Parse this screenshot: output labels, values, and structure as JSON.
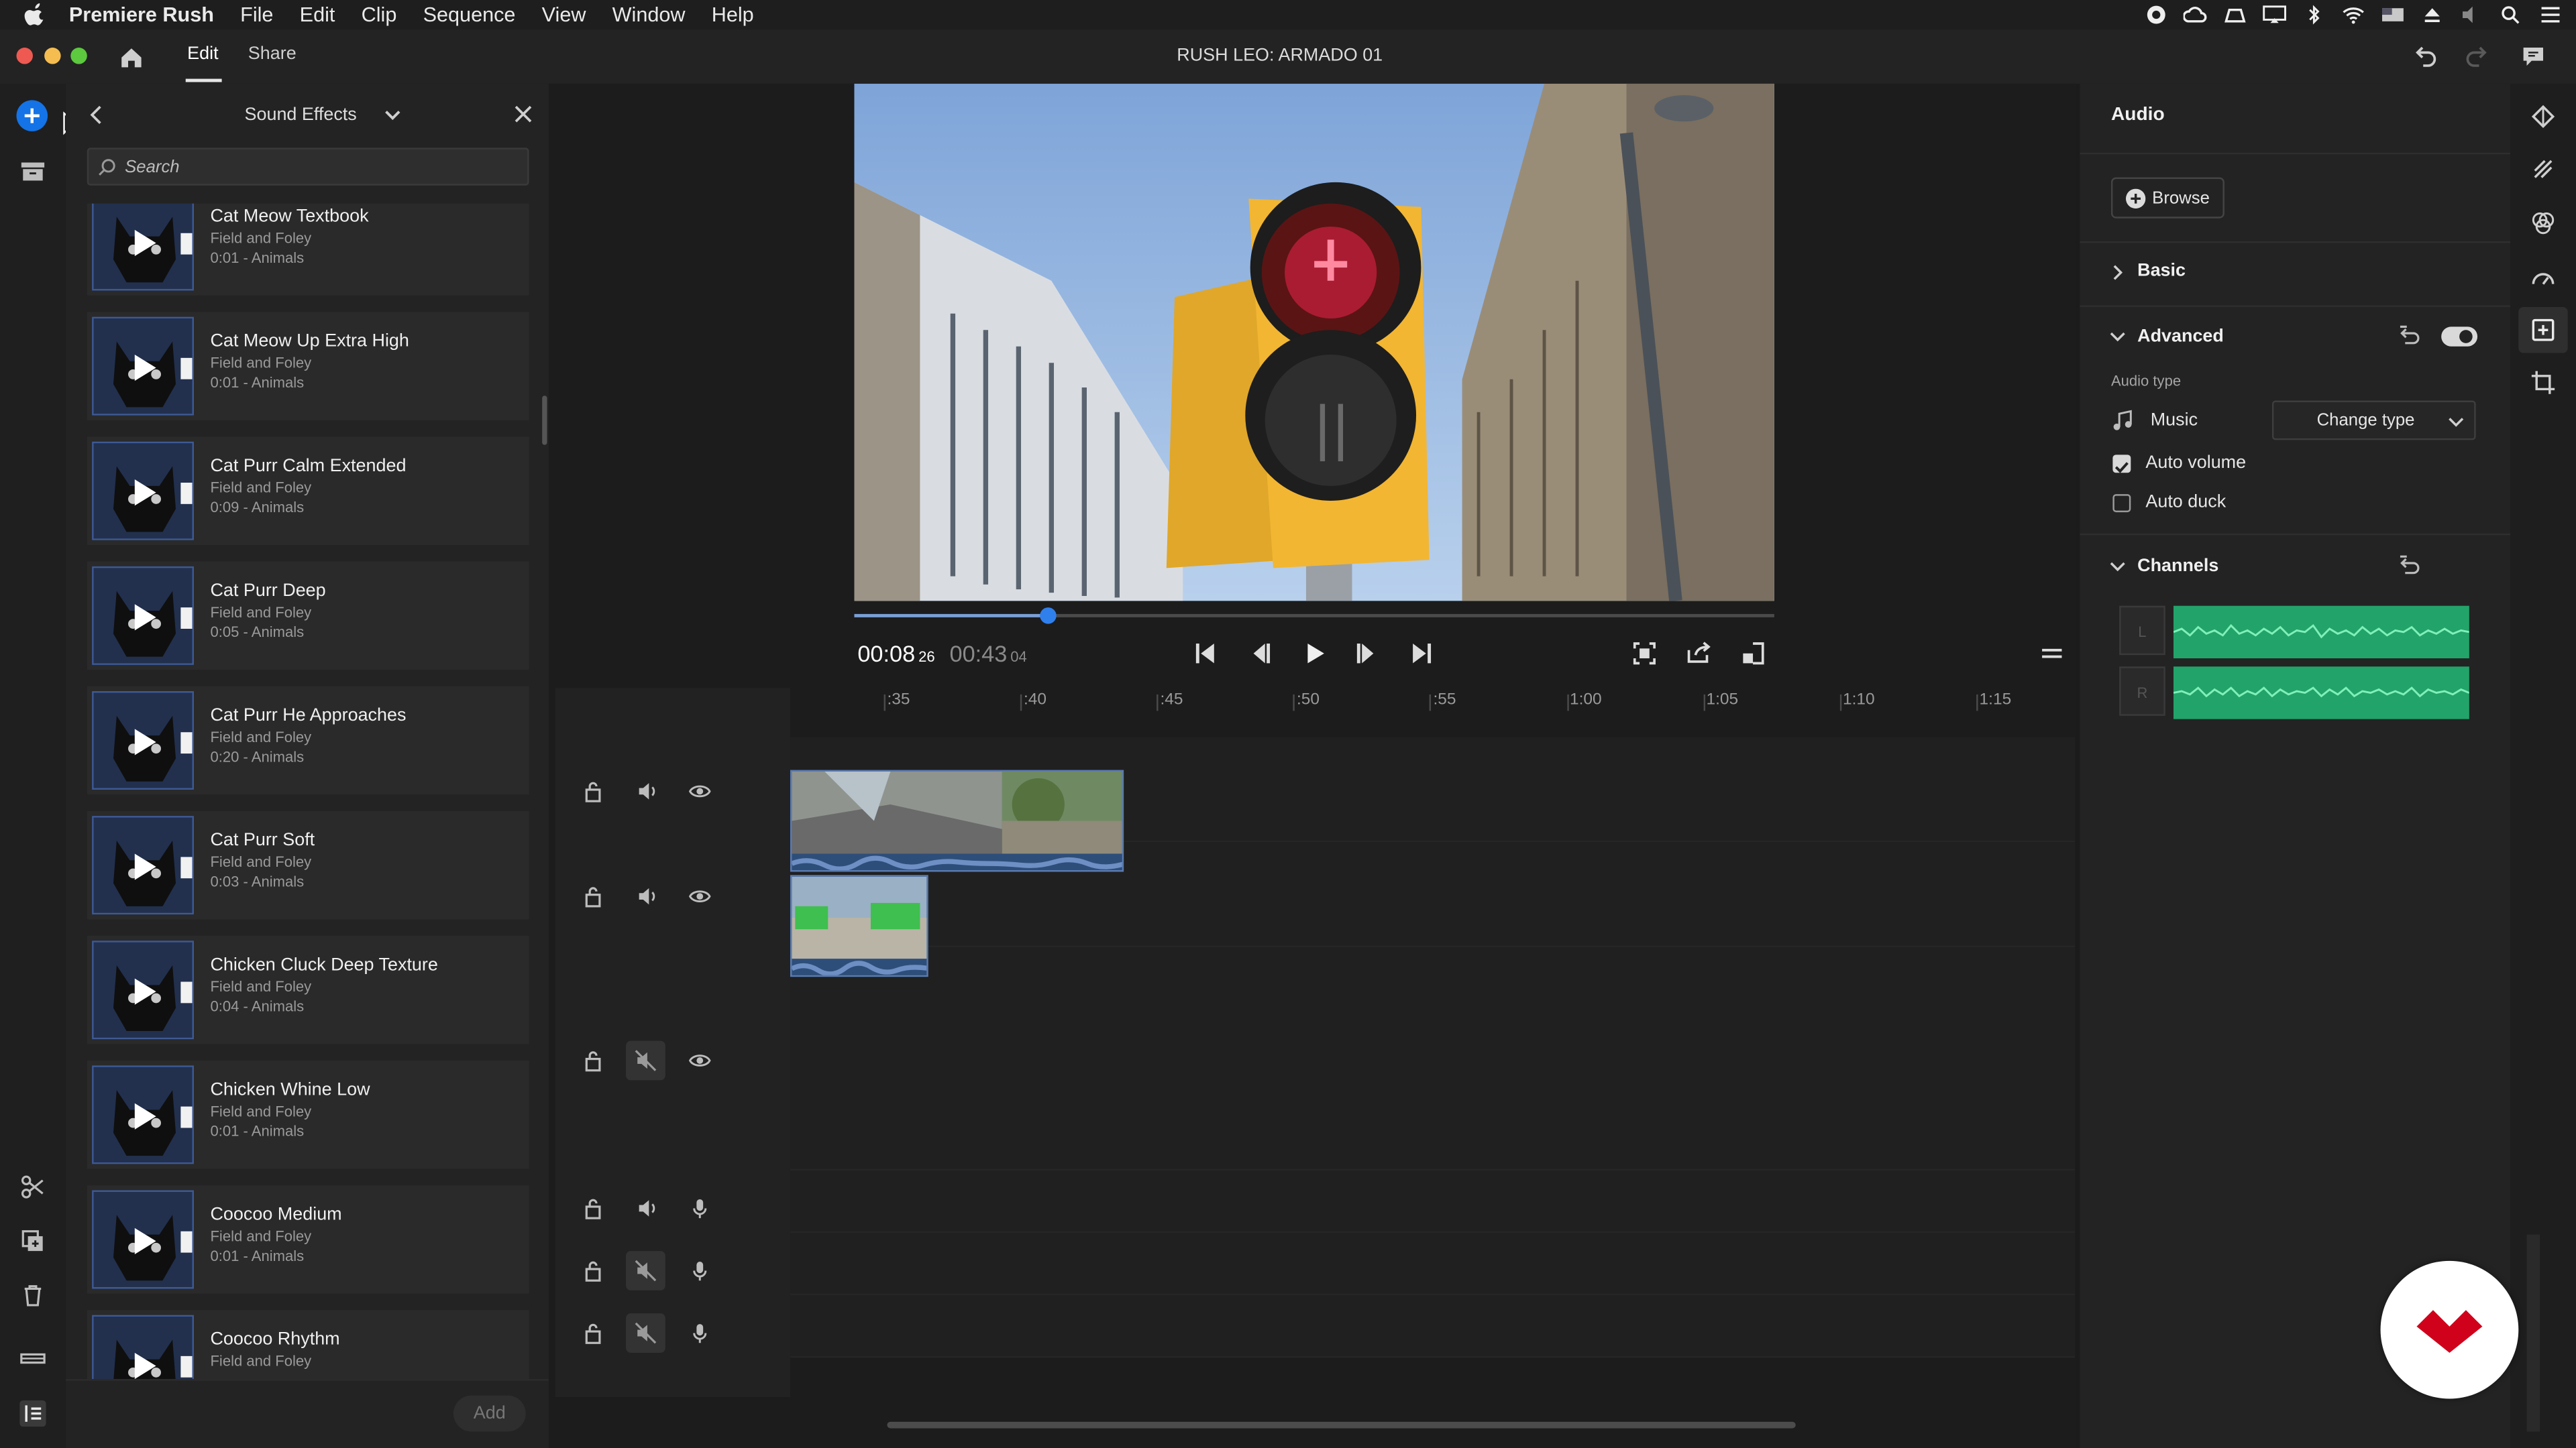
{
  "menubar": {
    "app_name": "Premiere Rush",
    "items": [
      "File",
      "Edit",
      "Clip",
      "Sequence",
      "View",
      "Window",
      "Help"
    ]
  },
  "titlebar": {
    "tabs": [
      "Edit",
      "Share"
    ],
    "active_tab": "Edit",
    "project_title": "RUSH LEO: ARMADO 01"
  },
  "sound_effects": {
    "title": "Sound Effects",
    "search_placeholder": "Search",
    "add_label": "Add",
    "items": [
      {
        "name": "Cat Meow Textbook",
        "category": "Field and Foley",
        "meta": "0:01 - Animals"
      },
      {
        "name": "Cat Meow Up Extra High",
        "category": "Field and Foley",
        "meta": "0:01 - Animals"
      },
      {
        "name": "Cat Purr Calm Extended",
        "category": "Field and Foley",
        "meta": "0:09 - Animals"
      },
      {
        "name": "Cat Purr Deep",
        "category": "Field and Foley",
        "meta": "0:05 - Animals"
      },
      {
        "name": "Cat Purr He Approaches",
        "category": "Field and Foley",
        "meta": "0:20 - Animals"
      },
      {
        "name": "Cat Purr Soft",
        "category": "Field and Foley",
        "meta": "0:03 - Animals"
      },
      {
        "name": "Chicken Cluck Deep Texture",
        "category": "Field and Foley",
        "meta": "0:04 - Animals"
      },
      {
        "name": "Chicken Whine Low",
        "category": "Field and Foley",
        "meta": "0:01 - Animals"
      },
      {
        "name": "Coocoo Medium",
        "category": "Field and Foley",
        "meta": "0:01 - Animals"
      },
      {
        "name": "Coocoo Rhythm",
        "category": "Field and Foley",
        "meta": ""
      }
    ]
  },
  "player": {
    "current_time": "00:08",
    "current_frames": "26",
    "total_time": "00:43",
    "total_frames": "04",
    "progress_fraction": 0.21
  },
  "timeline": {
    "ruler_ticks": [
      ":35",
      ":40",
      ":45",
      ":50",
      ":55",
      "1:00",
      "1:05",
      "1:10",
      "1:15"
    ]
  },
  "audio_panel": {
    "title": "Audio",
    "browse_label": "Browse",
    "basic_label": "Basic",
    "advanced_label": "Advanced",
    "audio_type_label": "Audio type",
    "audio_type_value": "Music",
    "change_type_label": "Change type",
    "auto_volume_label": "Auto volume",
    "auto_volume_checked": true,
    "auto_duck_label": "Auto duck",
    "auto_duck_checked": false,
    "channels_label": "Channels",
    "channel_left": "L",
    "channel_right": "R"
  },
  "colors": {
    "accent_blue": "#1473e6",
    "waveform_green": "#22a36a",
    "badge_red": "#d0021b"
  }
}
